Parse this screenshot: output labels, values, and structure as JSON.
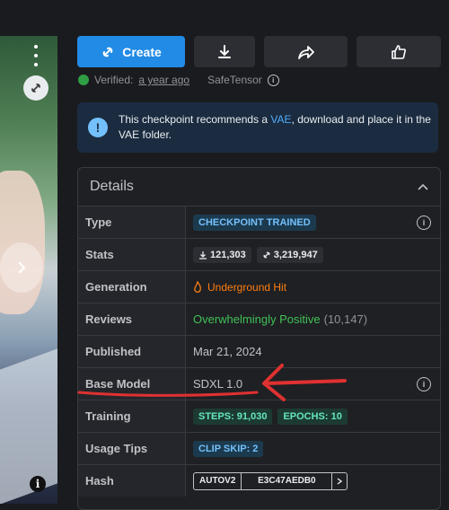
{
  "toolbar": {
    "create_label": "Create",
    "download_icon": "download-icon",
    "share_icon": "share-icon",
    "like_icon": "thumbs-up-icon"
  },
  "meta": {
    "verified_label": "Verified:",
    "verified_time": "a year ago",
    "format": "SafeTensor"
  },
  "alert": {
    "text_before": "This checkpoint recommends a ",
    "vae_link": "VAE",
    "text_after": ", download and place it in the VAE folder."
  },
  "details": {
    "title": "Details",
    "type": {
      "label": "Type",
      "value": "CHECKPOINT TRAINED"
    },
    "stats": {
      "label": "Stats",
      "downloads": "121,303",
      "generations": "3,219,947"
    },
    "generation": {
      "label": "Generation",
      "value": "Underground Hit"
    },
    "reviews": {
      "label": "Reviews",
      "value": "Overwhelmingly Positive",
      "count": "(10,147)"
    },
    "published": {
      "label": "Published",
      "value": "Mar 21, 2024"
    },
    "base_model": {
      "label": "Base Model",
      "value": "SDXL 1.0"
    },
    "training": {
      "label": "Training",
      "steps": "STEPS: 91,030",
      "epochs": "EPOCHS: 10"
    },
    "usage": {
      "label": "Usage Tips",
      "clip": "CLIP SKIP: 2"
    },
    "hash": {
      "label": "Hash",
      "algo": "AUTOV2",
      "value": "E3C47AEDB0"
    }
  },
  "colors": {
    "accent": "#228be6",
    "annotation": "#e03131",
    "positive": "#40c057",
    "hit": "#fd7e14"
  }
}
